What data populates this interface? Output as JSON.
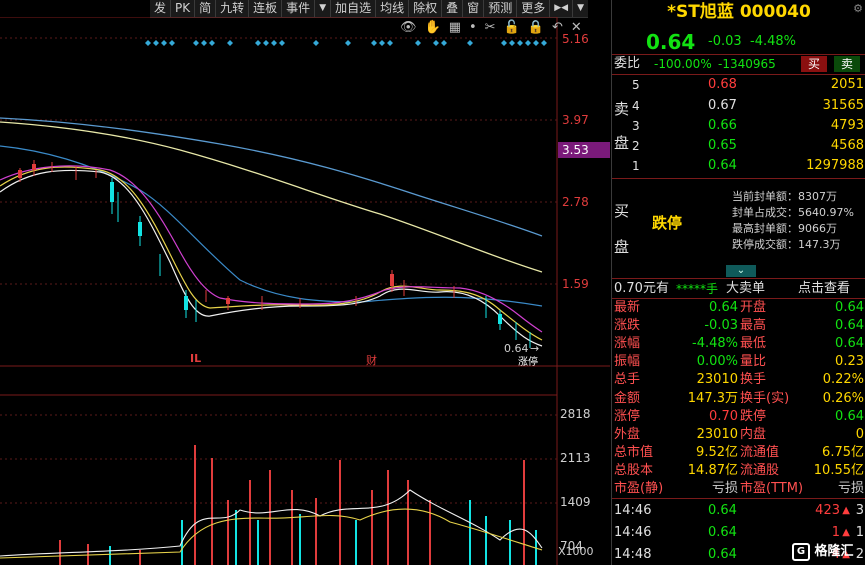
{
  "toolbar": {
    "items": [
      "发",
      "PK",
      "简",
      "九转",
      "连板",
      "事件",
      "▼",
      "加自选",
      "均线",
      "除权",
      "叠",
      "窗",
      "预测",
      "更多",
      "▶◀",
      "▼"
    ],
    "settings_icon": "gear-icon"
  },
  "chart": {
    "price_labels": [
      "5.16",
      "3.97",
      "3.53",
      "2.78",
      "1.59"
    ],
    "current_price_tag": "3.53",
    "low_label": "0.64",
    "low_arrow": "→",
    "event_label_1": "IL",
    "event_label_2": "财",
    "event_label_3": "涨停",
    "volume_labels": [
      "2818",
      "2113",
      "1409",
      "704"
    ],
    "volume_unit": "X1000",
    "tool_icons": [
      "eye-icon",
      "hand-icon",
      "grid-icon",
      "dot-icon",
      "scissors-icon",
      "unlock-icon",
      "lock-icon",
      "back-icon",
      "close-icon"
    ]
  },
  "quote": {
    "name": "*ST旭蓝",
    "code": "000040",
    "price": "0.64",
    "change": "-0.03",
    "change_pct": "-4.48%",
    "weibi_label": "委比",
    "weibi_value": "-100.00%",
    "weicha_value": "-1340965",
    "buy_btn": "买",
    "sell_btn": "卖"
  },
  "sell_book": {
    "side_label_1": "卖",
    "side_label_2": "盘",
    "levels": [
      {
        "level": "5",
        "price": "0.68",
        "vol": "2051"
      },
      {
        "level": "4",
        "price": "0.67",
        "vol": "31565"
      },
      {
        "level": "3",
        "price": "0.66",
        "vol": "4793"
      },
      {
        "level": "2",
        "price": "0.65",
        "vol": "4568"
      },
      {
        "level": "1",
        "price": "0.64",
        "vol": "1297988"
      }
    ]
  },
  "buy_book": {
    "side_label_1": "买",
    "side_label_2": "盘",
    "status": "跌停",
    "stats": [
      {
        "label": "当前封单额：",
        "value": "8307万"
      },
      {
        "label": "封单占成交：",
        "value": "5640.97%"
      },
      {
        "label": "最高封单额：",
        "value": "9066万"
      },
      {
        "label": "跌停成交额：",
        "value": "147.3万"
      }
    ]
  },
  "big_order": {
    "price": "0.70元有",
    "stars": "*****手",
    "title": "大卖单",
    "link": "点击查看"
  },
  "stats": [
    [
      "最新",
      "0.64",
      "开盘",
      "0.64"
    ],
    [
      "涨跌",
      "-0.03",
      "最高",
      "0.64"
    ],
    [
      "涨幅",
      "-4.48%",
      "最低",
      "0.64"
    ],
    [
      "振幅",
      "0.00%",
      "量比",
      "0.23"
    ],
    [
      "总手",
      "23010",
      "换手",
      "0.22%"
    ],
    [
      "金额",
      "147.3万",
      "换手(实)",
      "0.26%"
    ],
    [
      "涨停",
      "0.70",
      "跌停",
      "0.64"
    ],
    [
      "外盘",
      "23010",
      "内盘",
      "0"
    ],
    [
      "总市值",
      "9.52亿",
      "流通值",
      "6.75亿"
    ],
    [
      "总股本",
      "14.87亿",
      "流通股",
      "10.55亿"
    ],
    [
      "市盈(静)",
      "亏损",
      "市盈(TTM)",
      "亏损"
    ]
  ],
  "ticks": [
    {
      "time": "14:46",
      "price": "0.64",
      "vol": "423",
      "flag": "3"
    },
    {
      "time": "14:46",
      "price": "0.64",
      "vol": "1",
      "flag": "1"
    },
    {
      "time": "14:48",
      "price": "0.64",
      "vol": "4",
      "flag": "2"
    }
  ],
  "watermark": "格隆汇"
}
